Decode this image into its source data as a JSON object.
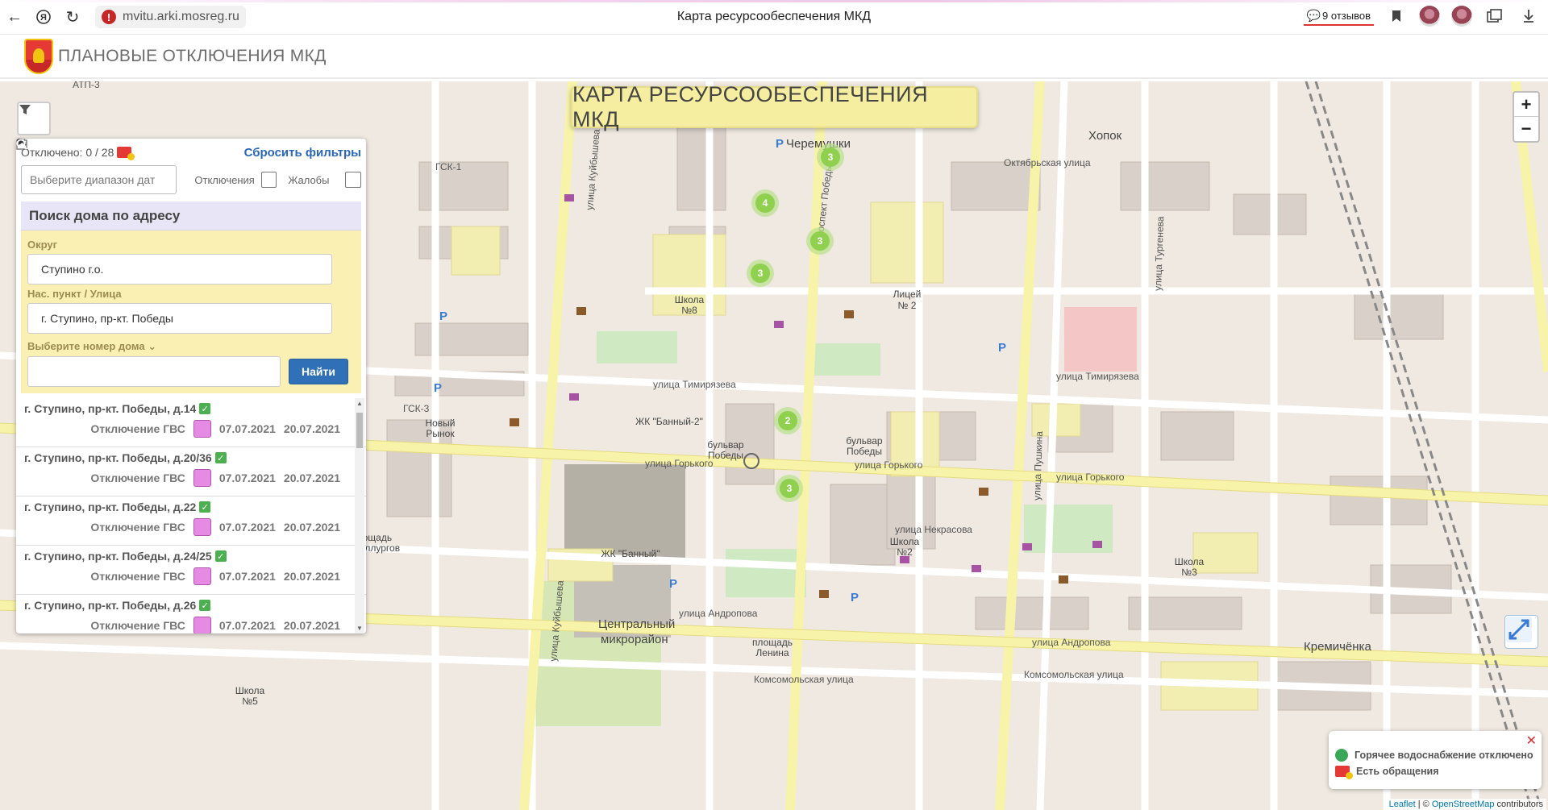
{
  "browser": {
    "url": "mvitu.arki.mosreg.ru",
    "tab_title": "Карта ресурсообеспечения МКД",
    "reviews": "9 отзывов"
  },
  "site": {
    "title": "ПЛАНОВЫЕ ОТКЛЮЧЕНИЯ МКД"
  },
  "map": {
    "title": "КАРТА РЕСУРСООБЕСПЕЧЕНИЯ МКД",
    "zoom_in": "+",
    "zoom_out": "−",
    "clusters": [
      {
        "count": "3"
      },
      {
        "count": "4"
      },
      {
        "count": "3"
      },
      {
        "count": "3"
      },
      {
        "count": "2"
      },
      {
        "count": "3"
      }
    ],
    "labels": {
      "cheremushki": "Черемушки",
      "hopok": "Хопок",
      "kremenchuka": "Кремичёнка",
      "centr": "Центральный",
      "mikrorayon": "микрорайон",
      "bulvar1": "бульвар",
      "pobedy1": "Победы",
      "bulvar2": "бульвар",
      "pobedy2": "Победы",
      "timiryazeva": "улица Тимирязева",
      "gorkogo": "улица Горького",
      "andropova": "улица Андропова",
      "komsomolskaya": "Комсомольская улица",
      "kuybysheva": "улица Куйбышева",
      "pushkina": "улица Пушкина",
      "oktyabrskaya": "Октябрьская улица",
      "nekrasova": "улица Некрасова",
      "turgeneva": "улица Тургенева",
      "licey": "Лицей",
      "licey_num": "№ 2",
      "school8": "Школа",
      "school8_num": "№8",
      "school2": "Школа",
      "school2_num": "№2",
      "school3": "Школа",
      "school3_num": "№3",
      "school5": "Школа",
      "school5_num": "№5",
      "zhk": "ЖК \"Банный\"",
      "zhk2": "ЖК \"Банный-2\"",
      "ploshchad_lenina": "площадь",
      "ploshchad_lenina2": "Ленина",
      "ploshchad_metal": "Площадь",
      "ploshchad_metal2": "Металлургов",
      "noviy_rynok": "Новый",
      "noviy_rynok2": "Рынок",
      "pr_pobedy": "проспект Победы",
      "gsk1": "ГСК-1",
      "gsk3": "ГСК-3",
      "atp": "АТП-3"
    }
  },
  "panel": {
    "off_count": "Отключено: 0 / 28",
    "reset": "Сбросить фильтры",
    "date_placeholder": "Выберите диапазон дат",
    "chk_off": "Отключения",
    "chk_complaints": "Жалобы",
    "search_title": "Поиск дома по адресу",
    "okrug_label": "Округ",
    "okrug_value": "Ступино г.о.",
    "street_label": "Нас. пункт / Улица",
    "street_value": "г. Ступино, пр-кт. Победы",
    "house_label": "Выберите номер дома",
    "find_btn": "Найти",
    "results": [
      {
        "address": "г. Ступино, пр-кт. Победы, д.14",
        "type": "Отключение ГВС",
        "from": "07.07.2021",
        "to": "20.07.2021"
      },
      {
        "address": "г. Ступино, пр-кт. Победы, д.20/36",
        "type": "Отключение ГВС",
        "from": "07.07.2021",
        "to": "20.07.2021"
      },
      {
        "address": "г. Ступино, пр-кт. Победы, д.22",
        "type": "Отключение ГВС",
        "from": "07.07.2021",
        "to": "20.07.2021"
      },
      {
        "address": "г. Ступино, пр-кт. Победы, д.24/25",
        "type": "Отключение ГВС",
        "from": "07.07.2021",
        "to": "20.07.2021"
      },
      {
        "address": "г. Ступино, пр-кт. Победы, д.26",
        "type": "Отключение ГВС",
        "from": "07.07.2021",
        "to": "20.07.2021"
      }
    ]
  },
  "legend": {
    "hot_water": "Горячее водоснабжение отключено",
    "complaints": "Есть обращения",
    "close": "✕"
  },
  "attribution": {
    "leaflet": "Leaflet",
    "sep": " | © ",
    "osm": "OpenStreetMap",
    "contrib": " contributors"
  },
  "colors": {
    "cluster": "#8fd04f",
    "road_major": "#f7f3a8",
    "accent": "#2f70b7"
  }
}
